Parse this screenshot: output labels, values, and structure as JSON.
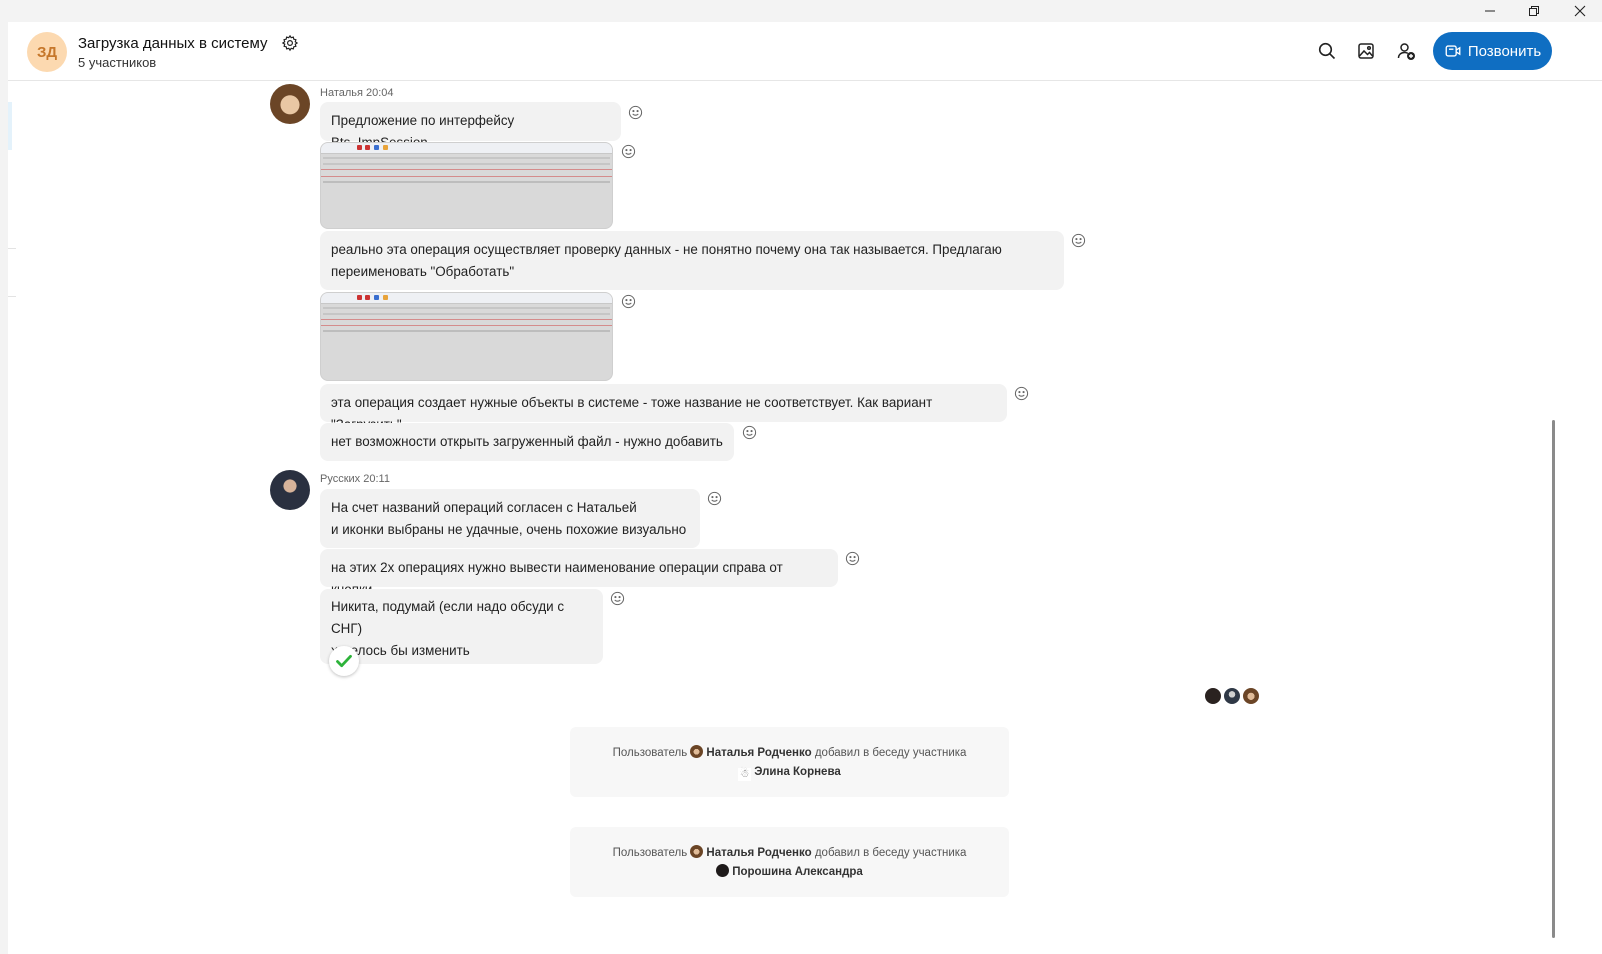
{
  "window": {
    "controls": [
      "minimize",
      "maximize",
      "close"
    ]
  },
  "header": {
    "avatar_initials": "ЗД",
    "title": "Загрузка данных в систему",
    "subtitle": "5 участников",
    "call_label": "Позвонить",
    "icons": [
      "search-icon",
      "gallery-icon",
      "add-participant-icon",
      "settings-icon",
      "video-call-icon"
    ]
  },
  "messages": [
    {
      "sender": "Наталья 20:04",
      "items": [
        {
          "type": "text",
          "text": "Предложение по интерфейсу  Bts_ImpSession"
        },
        {
          "type": "image"
        },
        {
          "type": "text",
          "text": "реально эта операция осуществляет проверку данных - не понятно почему она так называется. Предлагаю\nпереименовать \"Обработать\""
        },
        {
          "type": "image"
        },
        {
          "type": "text",
          "text": "эта операция создает нужные объекты в системе - тоже название не соответствует. Как вариант \"Загрузить\""
        },
        {
          "type": "text",
          "text": "нет возможности открыть загруженный файл - нужно добавить"
        }
      ]
    },
    {
      "sender": "Русских 20:11",
      "items": [
        {
          "type": "text",
          "text": "На счет названий операций согласен с Натальей\nи иконки выбраны не удачные, очень похожие визуально"
        },
        {
          "type": "text",
          "text": "на этих 2х операциях нужно вывести наименование операции справа от кнопки"
        },
        {
          "type": "text",
          "text": "Никита, подумай (если надо обсуди с СНГ)\nхотелось бы изменить",
          "reaction": "checkmark"
        }
      ]
    }
  ],
  "system_messages": [
    {
      "prefix": "Пользователь",
      "actor": "Наталья Родченко",
      "action": "добавил в беседу участника",
      "target": "Элина Корнева"
    },
    {
      "prefix": "Пользователь",
      "actor": "Наталья Родченко",
      "action": "добавил в беседу участника",
      "target": "Порошина Александра"
    }
  ],
  "colors": {
    "accent": "#0f6ec2",
    "bubble": "#f2f2f2",
    "avatar_bg": "#fcd9b0",
    "reaction_check": "#2db33a"
  }
}
